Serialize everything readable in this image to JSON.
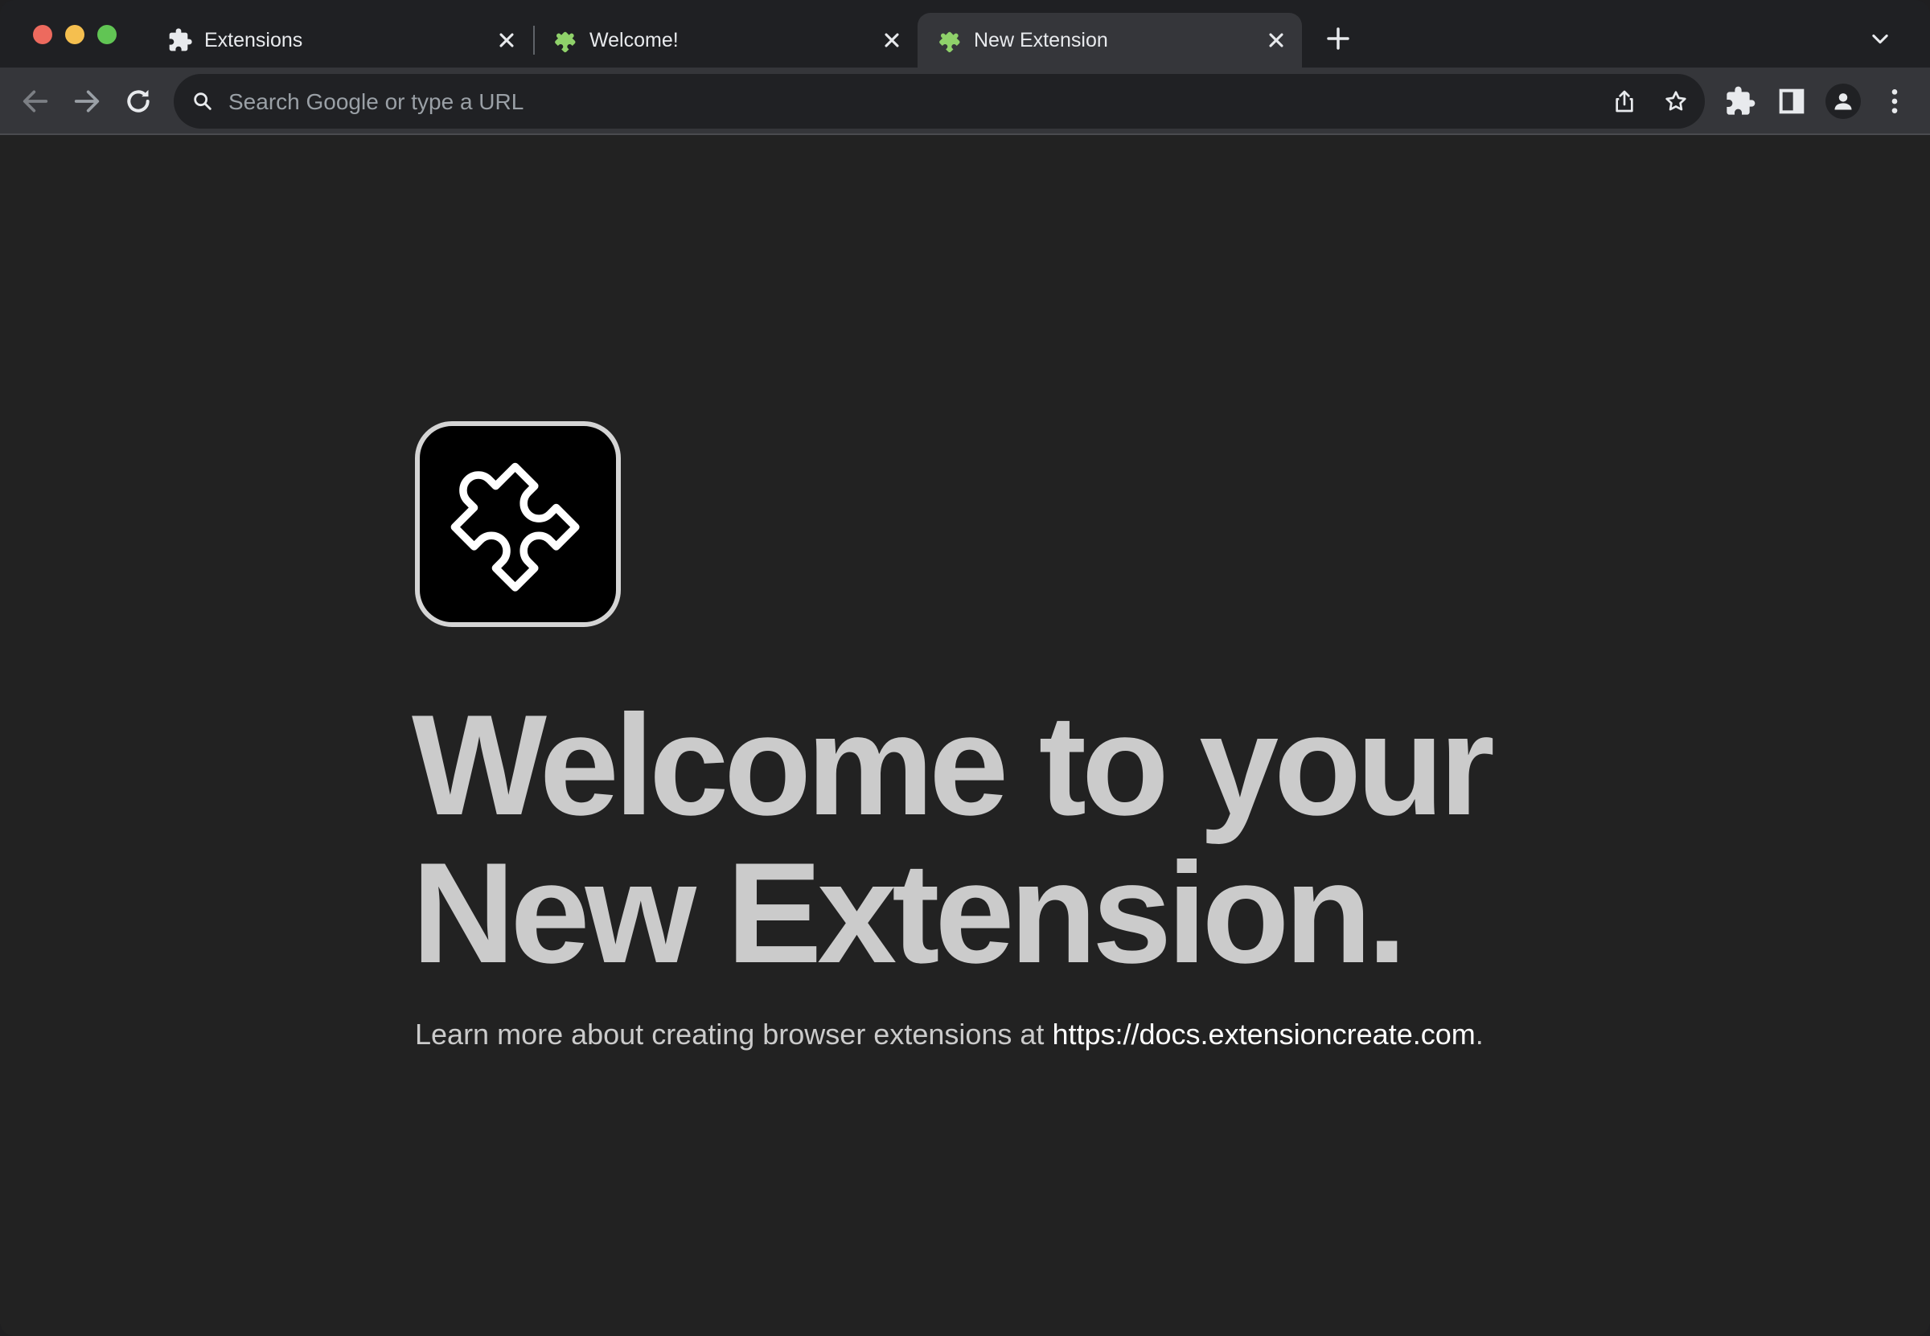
{
  "window": {
    "controls": [
      "close",
      "minimize",
      "maximize"
    ]
  },
  "tabs": [
    {
      "title": "Extensions",
      "icon": "puzzle-icon",
      "active": false
    },
    {
      "title": "Welcome!",
      "icon": "puzzle-color-icon",
      "active": false
    },
    {
      "title": "New Extension",
      "icon": "puzzle-color-icon",
      "active": true
    }
  ],
  "toolbar": {
    "omnibox_placeholder": "Search Google or type a URL",
    "omnibox_value": ""
  },
  "page": {
    "headline_line1": "Welcome to your",
    "headline_line2": "New Extension.",
    "learn_text": "Learn more about creating browser extensions at ",
    "learn_link": "https://docs.extensioncreate.com",
    "learn_suffix": "."
  },
  "colors": {
    "tab_strip": "#1f2023",
    "toolbar": "#35363a",
    "page_bg": "#222222",
    "headline": "#cbcbcb"
  }
}
